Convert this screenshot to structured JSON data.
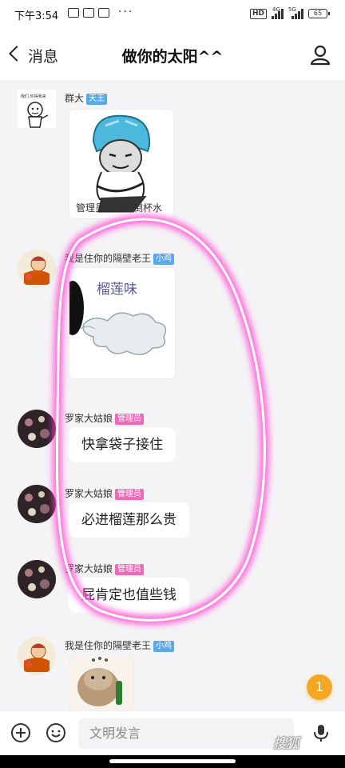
{
  "status_bar": {
    "time": "下午3:54",
    "hd": "HD",
    "net1": "4G",
    "net2": "5G",
    "battery": "65"
  },
  "header": {
    "back_label": "消息",
    "title": "做你的太阳^^"
  },
  "messages": [
    {
      "sender": "群大",
      "badge": "天王",
      "badge_color": "#58a8ea",
      "avatar_caption": "我们,你得我来",
      "sticker_caption": "管理员，给我倒杯水"
    },
    {
      "sender": "我是住你的隔壁老王",
      "badge": "小鸡",
      "badge_color": "#58a8ea",
      "sticker_text": "榴莲味"
    },
    {
      "sender": "罗家大姑娘",
      "badge": "管理员",
      "badge_color": "#ec6bb6",
      "text": "快拿袋子接住"
    },
    {
      "sender": "罗家大姑娘",
      "badge": "管理员",
      "badge_color": "#ec6bb6",
      "text": "必进榴莲那么贵"
    },
    {
      "sender": "罗家大姑娘",
      "badge": "管理员",
      "badge_color": "#ec6bb6",
      "text": "屁肯定也值些钱"
    },
    {
      "sender": "我是住你的隔壁老王",
      "badge": "小鸡",
      "badge_color": "#58a8ea"
    }
  ],
  "unread_count": "1",
  "input": {
    "placeholder": "文明发言"
  },
  "watermark": "搜狐"
}
